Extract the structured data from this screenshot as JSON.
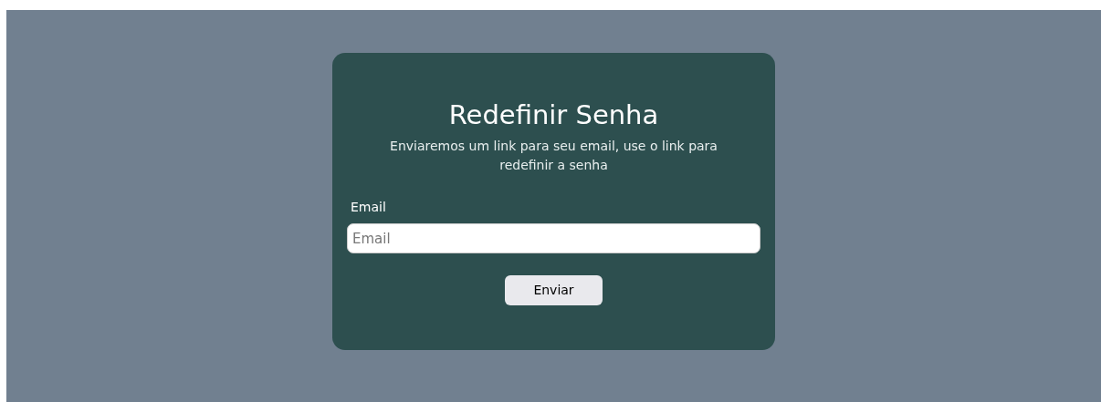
{
  "card": {
    "title": "Redefinir Senha",
    "description": "Enviaremos um link para seu email, use o link para redefinir a senha"
  },
  "email_field": {
    "label": "Email",
    "placeholder": "Email"
  },
  "submit_button": {
    "label": "Enviar"
  }
}
